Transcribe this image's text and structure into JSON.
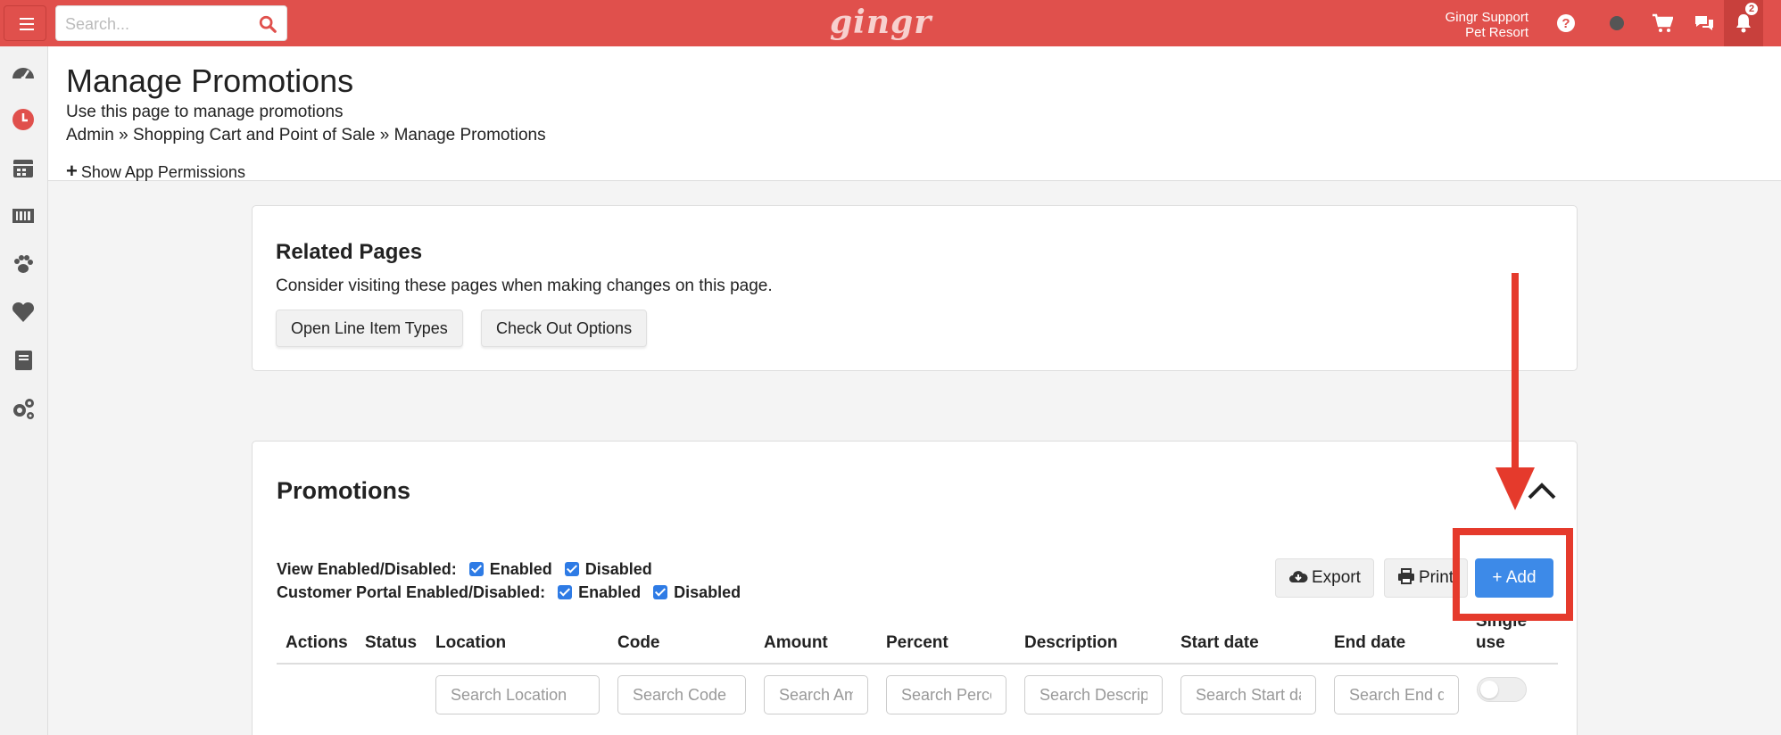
{
  "topbar": {
    "search_placeholder": "Search...",
    "logo": "gingr",
    "user_line1": "Gingr Support",
    "user_line2": "Pet Resort",
    "notification_count": "2"
  },
  "header": {
    "title": "Manage Promotions",
    "subtitle": "Use this page to manage promotions",
    "breadcrumb": "Admin » Shopping Cart and Point of Sale » Manage Promotions",
    "permissions_link": "Show App Permissions"
  },
  "related": {
    "title": "Related Pages",
    "description": "Consider visiting these pages when making changes on this page.",
    "buttons": [
      "Open Line Item Types",
      "Check Out Options"
    ]
  },
  "promotions": {
    "title": "Promotions",
    "filter1_label": "View Enabled/Disabled:",
    "filter2_label": "Customer Portal Enabled/Disabled:",
    "enabled_label": "Enabled",
    "disabled_label": "Disabled",
    "export_label": "Export",
    "print_label": "Print",
    "add_label": "+ Add",
    "columns": [
      "Actions",
      "Status",
      "Location",
      "Code",
      "Amount",
      "Percent",
      "Description",
      "Start date",
      "End date",
      "Single use"
    ],
    "search_placeholders": [
      "Search Location",
      "Search Code",
      "Search Amount",
      "Search Percent",
      "Search Description",
      "Search Start date",
      "Search End date"
    ]
  },
  "colors": {
    "brand": "#e0504c",
    "accent": "#3d8ae8",
    "annotation": "#e53a2c"
  }
}
